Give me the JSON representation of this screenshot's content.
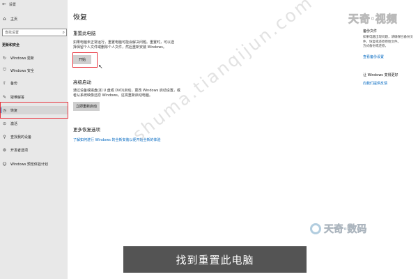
{
  "window": {
    "title": "设置"
  },
  "sidebar": {
    "home_label": "主页",
    "search_placeholder": "查找设置",
    "section_label": "更新和安全",
    "items": [
      {
        "label": "Windows 更新",
        "icon": "refresh-icon",
        "active": false
      },
      {
        "label": "Windows 安全",
        "icon": "shield-icon",
        "active": false
      },
      {
        "label": "备份",
        "icon": "upload-icon",
        "active": false
      },
      {
        "label": "疑难解答",
        "icon": "wrench-icon",
        "active": false
      },
      {
        "label": "恢复",
        "icon": "history-icon",
        "active": true
      },
      {
        "label": "激活",
        "icon": "check-circle-icon",
        "active": false
      },
      {
        "label": "查找我的设备",
        "icon": "person-locate-icon",
        "active": false
      },
      {
        "label": "开发者选项",
        "icon": "dev-icon",
        "active": false
      },
      {
        "label": "Windows 预览体验计划",
        "icon": "smiley-icon",
        "active": false
      }
    ]
  },
  "main": {
    "title": "恢复",
    "reset": {
      "title": "重置此电脑",
      "desc_line1": "如果电脑未正常运行，重置电脑可能会解决问题。重置时，可以选",
      "desc_line2": "择保留个人文件或删除个人文件，然后重新安装 Windows。",
      "button": "开始"
    },
    "advanced": {
      "title": "高级启动",
      "desc_line1": "通过设备或磁盘(如 U 盘或 DVD)启动，更改 Windows 启动设置，或",
      "desc_line2": "者从系统映像还原 Windows。这将重新启动电脑。",
      "button": "立即重新启动"
    },
    "more": {
      "title": "更多恢复选项",
      "link": "了解如何进行 Windows 的全新安装以便开始全新的体验"
    }
  },
  "right": {
    "backup_head": "备份文件",
    "backup_desc_1": "如果电脑出现问题，请确保已备份文件，恢复或还原原始文件。",
    "backup_desc_2": "方式备份或还原。",
    "backup_link": "查看备份设置",
    "improve_head": "让 Windows 变得更好",
    "improve_link": "向我们提供反馈"
  },
  "watermarks": {
    "top": "天奇·视频",
    "bottom": "天奇·数码",
    "diagonal": "shuma.tianqijun.com"
  },
  "subtitle": "找到重置此电脑",
  "colors": {
    "accent": "#0067c0",
    "highlight": "#e8323c",
    "sidebar_bg": "#e8e8e8"
  }
}
